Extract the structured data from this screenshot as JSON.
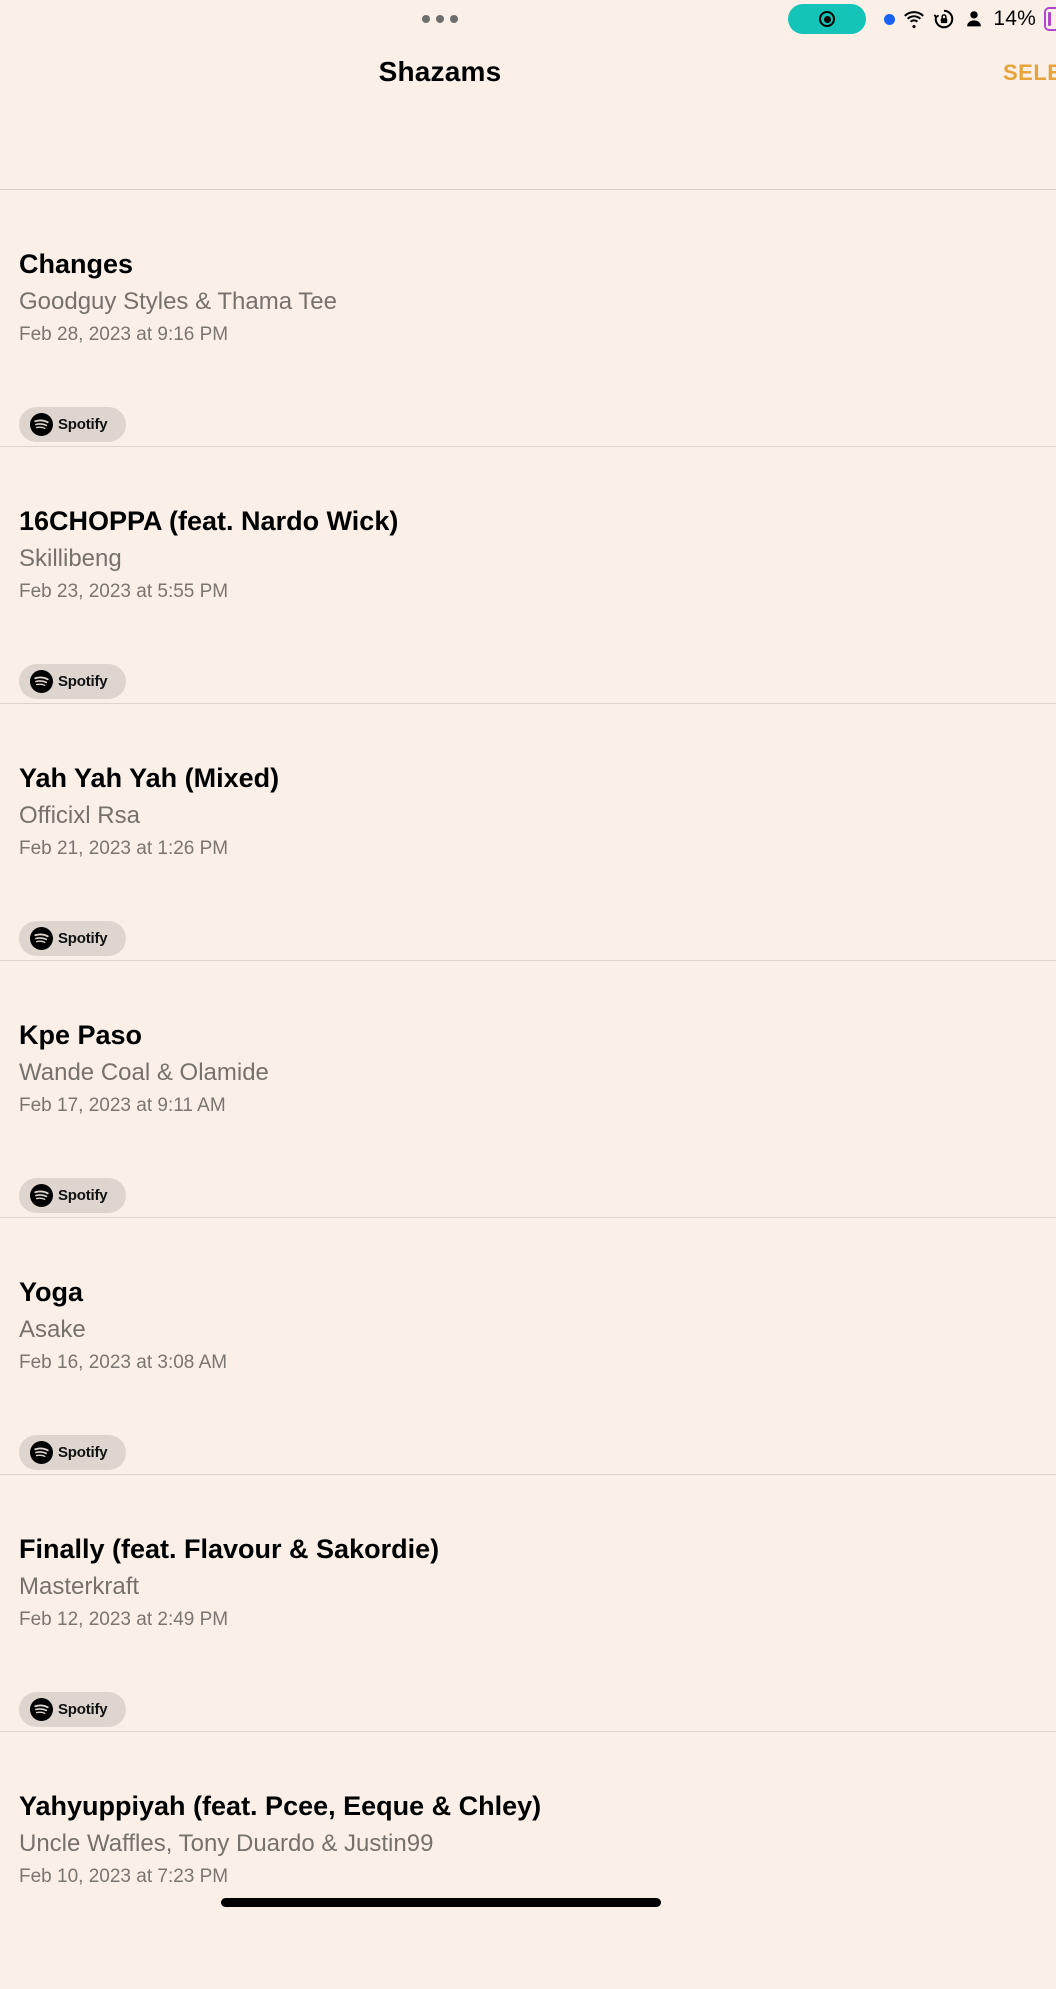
{
  "status_bar": {
    "battery_percent": "14%",
    "colors": {
      "screen_record_pill": "#15c4b8",
      "location_dot": "#1a63f5",
      "battery": "#b046c9"
    },
    "icons": [
      "multitasking-dots-icon",
      "screen-record-icon",
      "wifi-icon",
      "screen-lock-rotation-icon",
      "person-icon",
      "battery-icon"
    ]
  },
  "nav": {
    "title": "Shazams",
    "select_label": "SELE",
    "accent_color": "#e8a33a"
  },
  "tracks": [
    {
      "title": "Changes",
      "artist": "Goodguy Styles & Thama Tee",
      "date": "Feb 28, 2023 at 9:16 PM",
      "service": "Spotify"
    },
    {
      "title": "16CHOPPA (feat. Nardo Wick)",
      "artist": "Skillibeng",
      "date": "Feb 23, 2023 at 5:55 PM",
      "service": "Spotify"
    },
    {
      "title": "Yah Yah Yah (Mixed)",
      "artist": "Officixl Rsa",
      "date": "Feb 21, 2023 at 1:26 PM",
      "service": "Spotify"
    },
    {
      "title": "Kpe Paso",
      "artist": "Wande Coal & Olamide",
      "date": "Feb 17, 2023 at 9:11 AM",
      "service": "Spotify"
    },
    {
      "title": "Yoga",
      "artist": "Asake",
      "date": "Feb 16, 2023 at 3:08 AM",
      "service": "Spotify"
    },
    {
      "title": "Finally (feat. Flavour & Sakordie)",
      "artist": "Masterkraft",
      "date": "Feb 12, 2023 at 2:49 PM",
      "service": "Spotify"
    },
    {
      "title": "Yahyuppiyah (feat. Pcee, Eeque & Chley)",
      "artist": "Uncle Waffles, Tony Duardo & Justin99",
      "date": "Feb 10, 2023 at 7:23 PM",
      "service": null
    }
  ]
}
